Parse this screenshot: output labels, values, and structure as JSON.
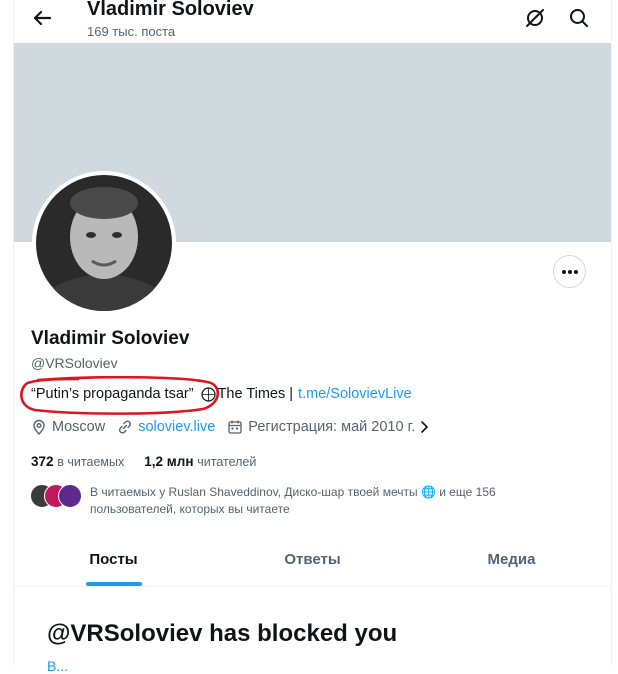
{
  "header": {
    "title": "Vladimir Soloviev",
    "posts_count": "169 тыс. поста"
  },
  "profile": {
    "name": "Vladimir Soloviev",
    "handle": "@VRSoloviev",
    "bio_quote": "“Putin’s propaganda tsar”",
    "bio_source": "The Times |",
    "bio_link": "t.me/SolovievLive",
    "location": "Moscow",
    "website": "soloviev.live",
    "joined": "Регистрация: май 2010 г.",
    "following_count": "372",
    "following_label": "в читаемых",
    "followers_count": "1,2 млн",
    "followers_label": "читателей",
    "followed_by_text": "В читаемых у Ruslan Shaveddinov, Диско-шар твоей мечты 🌐 и еще 156 пользователей, которых вы читаете"
  },
  "tabs": [
    {
      "label": "Посты",
      "active": true
    },
    {
      "label": "Ответы",
      "active": false
    },
    {
      "label": "Медиа",
      "active": false
    }
  ],
  "blocked": {
    "title": "@VRSoloviev has blocked you",
    "subtitle": "В..."
  },
  "colors": {
    "accent": "#1d9bf0",
    "banner": "#cfd9de",
    "annotation": "#e0141e"
  }
}
